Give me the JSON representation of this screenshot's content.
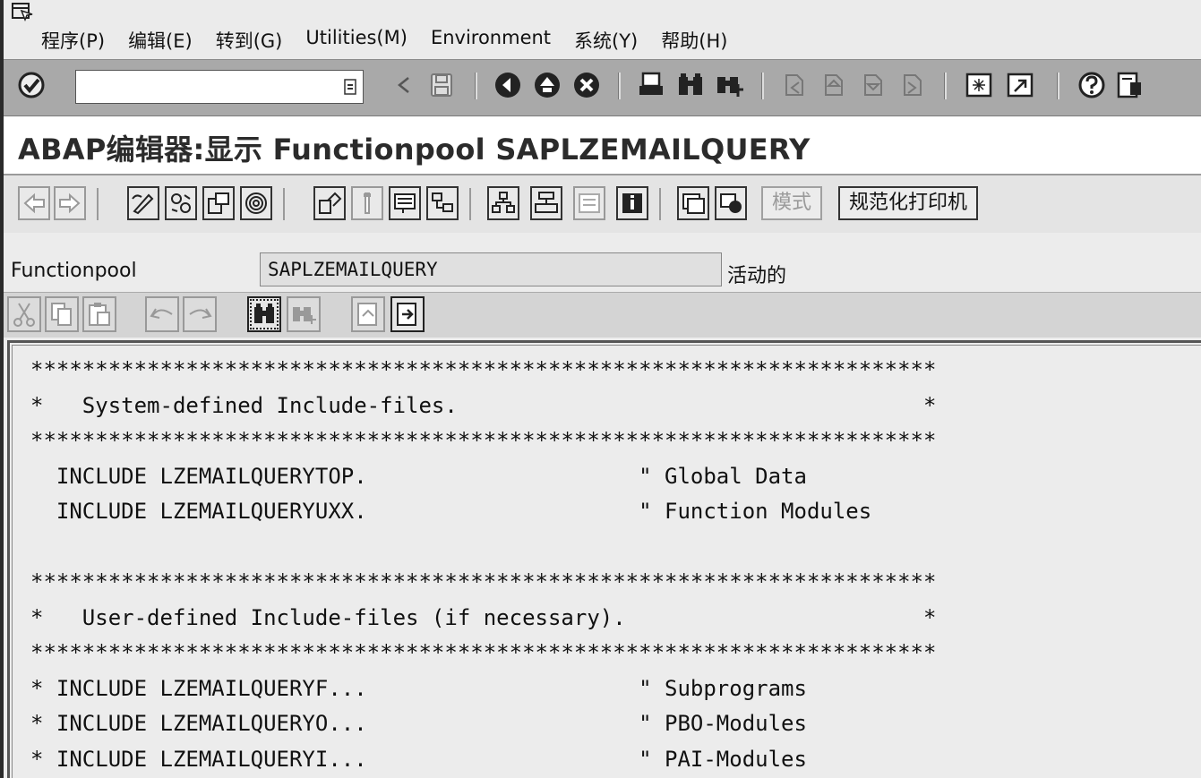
{
  "menu": {
    "items": [
      "程序(P)",
      "编辑(E)",
      "转到(G)",
      "Utilities(M)",
      "Environment",
      "系统(Y)",
      "帮助(H)"
    ]
  },
  "system_toolbar": {
    "command_field_value": "",
    "icons": [
      "enter-check-icon",
      "dropdown-icon",
      "back-arrow-icon",
      "save-icon",
      "back-icon",
      "exit-icon",
      "cancel-icon",
      "print-icon",
      "find-icon",
      "find-next-icon",
      "first-page-icon",
      "previous-page-icon",
      "next-page-icon",
      "last-page-icon",
      "new-session-icon",
      "shortcut-icon",
      "help-icon",
      "layout-menu-icon"
    ]
  },
  "title": "ABAP编辑器:显示 Functionpool SAPLZEMAILQUERY",
  "app_toolbar": {
    "mode_button": "模式",
    "print_button": "规范化打印机"
  },
  "functionpool": {
    "label": "Functionpool",
    "value": "SAPLZEMAILQUERY",
    "status": "活动的"
  },
  "code_lines": [
    "**********************************************************************",
    "*   System-defined Include-files.                                    *",
    "**********************************************************************",
    "  INCLUDE LZEMAILQUERYTOP.                     \" Global Data",
    "  INCLUDE LZEMAILQUERYUXX.                     \" Function Modules",
    "",
    "**********************************************************************",
    "*   User-defined Include-files (if necessary).                       *",
    "**********************************************************************",
    "* INCLUDE LZEMAILQUERYF...                     \" Subprograms",
    "* INCLUDE LZEMAILQUERYO...                     \" PBO-Modules",
    "* INCLUDE LZEMAILQUERYI...                     \" PAI-Modules"
  ]
}
